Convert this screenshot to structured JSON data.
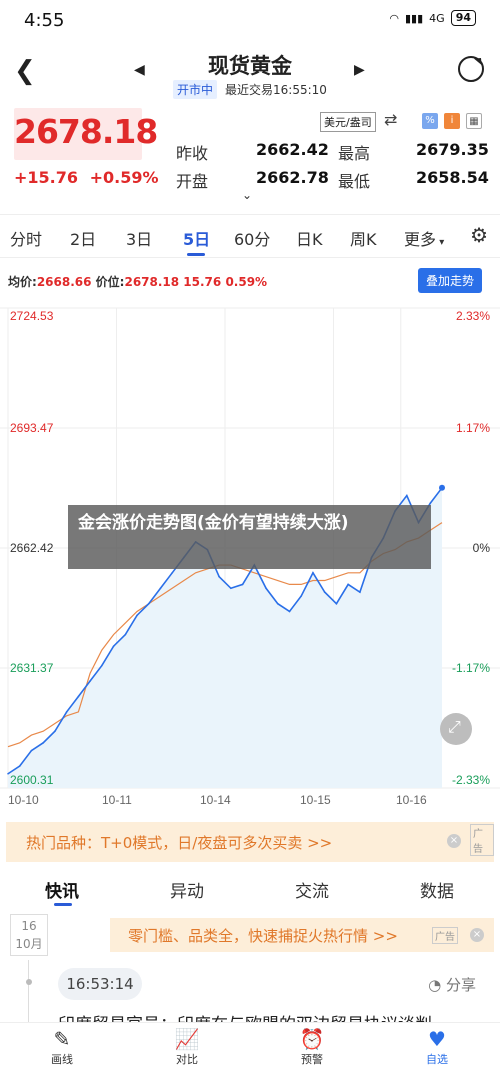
{
  "status_bar": {
    "time": "4:55",
    "signal": "4G",
    "battery": "94"
  },
  "header": {
    "title": "现货黄金",
    "market_status": "开市中",
    "last_trade": "最近交易16:55:10"
  },
  "quote": {
    "price": "2678.18",
    "change": "+15.76",
    "change_pct": "+0.59%",
    "unit": "美元/盎司",
    "prev_close_label": "昨收",
    "prev_close": "2662.42",
    "high_label": "最高",
    "high": "2679.35",
    "open_label": "开盘",
    "open": "2662.78",
    "low_label": "最低",
    "low": "2658.54"
  },
  "tabs": [
    "分时",
    "2日",
    "3日",
    "5日",
    "60分",
    "日K",
    "周K",
    "更多"
  ],
  "chart_header": {
    "avg_label": "均价:",
    "avg_value": "2668.66",
    "price_label": "价位:",
    "price_value": "2678.18 15.76 0.59%",
    "overlay_button": "叠加走势"
  },
  "banner_text": "金会涨价走势图(金价有望持续大涨)",
  "chart_data": {
    "type": "line",
    "x_labels": [
      "10-10",
      "10-11",
      "10-14",
      "10-15",
      "10-16"
    ],
    "y_labels_left": [
      "2724.53",
      "2693.47",
      "2662.42",
      "2631.37",
      "2600.31"
    ],
    "y_labels_right": [
      "2.33%",
      "1.17%",
      "0%",
      "-1.17%",
      "-2.33%"
    ],
    "ylim": [
      2600.31,
      2724.53
    ],
    "series": [
      {
        "values": [
          2604,
          2606,
          2610,
          2612,
          2615,
          2620,
          2624,
          2628,
          2632,
          2637,
          2640,
          2645,
          2648,
          2652,
          2656,
          2660,
          2664,
          2662,
          2655,
          2652,
          2653,
          2658,
          2652,
          2648,
          2646,
          2650,
          2656,
          2651,
          2648,
          2653,
          2651,
          2660,
          2665,
          2672,
          2676,
          2669,
          2674,
          2678
        ]
      },
      {
        "values": [
          2611,
          2612,
          2614,
          2615,
          2617,
          2619,
          2620,
          2630,
          2636,
          2640,
          2643,
          2646,
          2648,
          2650,
          2652,
          2654,
          2656,
          2657,
          2658,
          2658,
          2657,
          2656,
          2655,
          2654,
          2653,
          2653,
          2654,
          2654,
          2655,
          2656,
          2656,
          2659,
          2661,
          2662,
          2664,
          2665,
          2667,
          2669
        ]
      }
    ],
    "colors": {
      "price": "#2a6fe8",
      "average": "#e8894a",
      "fill": "#eaf4fb"
    }
  },
  "promo": {
    "text": "热门品种：T+0模式，日/夜盘可多次买卖 >>",
    "ad": "广告"
  },
  "news_tabs": [
    "快讯",
    "异动",
    "交流",
    "数据"
  ],
  "news": {
    "date_day": "16",
    "date_month": "10月",
    "promo2": "零门槛、品类全，快速捕捉火热行情 >>",
    "promo2_ad": "广告",
    "time": "16:53:14",
    "share": "分享",
    "headline": "印度贸易官员：印度在与欧盟的双边贸易协议谈判"
  },
  "bottom_nav": [
    "画线",
    "对比",
    "预警",
    "自选"
  ]
}
